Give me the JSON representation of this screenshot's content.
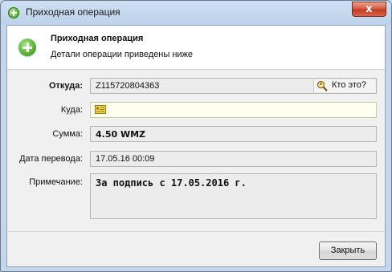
{
  "window": {
    "title": "Приходная операция",
    "close_glyph": "x"
  },
  "header": {
    "title": "Приходная операция",
    "subtitle": "Детали операции приведены ниже"
  },
  "form": {
    "from_label": "Откуда:",
    "from_value": "Z115720804363",
    "whois_label": "Кто это?",
    "to_label": "Куда:",
    "to_value": "",
    "amount_label": "Сумма:",
    "amount_value": "4.50 WMZ",
    "date_label": "Дата перевода:",
    "date_value": "17.05.16 00:09",
    "note_label": "Примечание:",
    "note_value": "За подпись с 17.05.2016 г."
  },
  "footer": {
    "close_label": "Закрыть"
  },
  "icons": {
    "title_icon": "add-circle-icon",
    "header_icon": "add-circle-icon",
    "whois_icon": "magnifier-user-icon",
    "to_icon": "wallet-card-icon"
  },
  "colors": {
    "accent_green": "#48a82a",
    "close_red": "#c0381f",
    "field_bg": "#ececec"
  }
}
